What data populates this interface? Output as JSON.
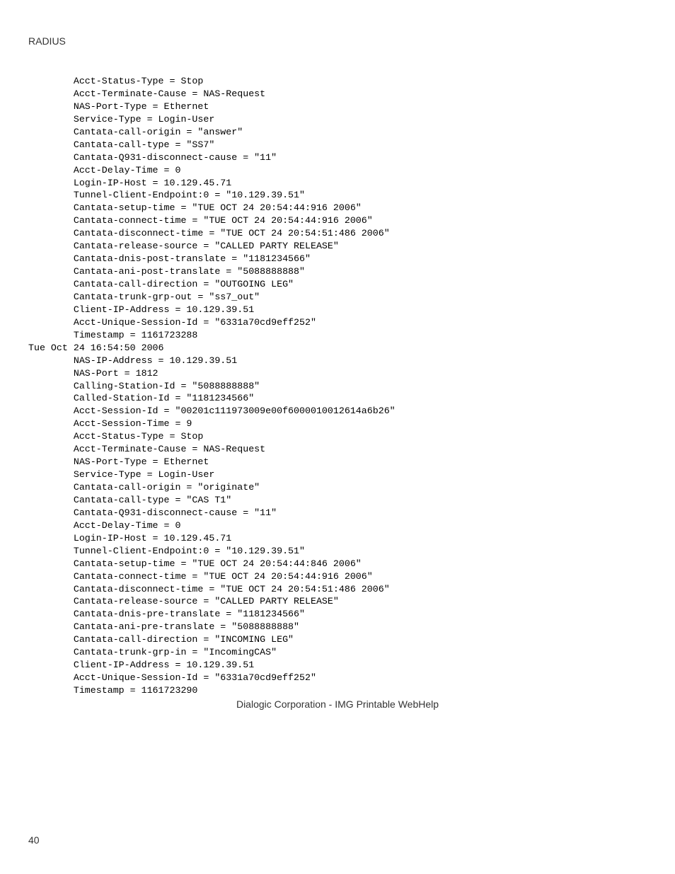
{
  "header": "RADIUS",
  "code": "        Acct-Status-Type = Stop\n        Acct-Terminate-Cause = NAS-Request\n        NAS-Port-Type = Ethernet\n        Service-Type = Login-User\n        Cantata-call-origin = \"answer\"\n        Cantata-call-type = \"SS7\"\n        Cantata-Q931-disconnect-cause = \"11\"\n        Acct-Delay-Time = 0\n        Login-IP-Host = 10.129.45.71\n        Tunnel-Client-Endpoint:0 = \"10.129.39.51\"\n        Cantata-setup-time = \"TUE OCT 24 20:54:44:916 2006\"\n        Cantata-connect-time = \"TUE OCT 24 20:54:44:916 2006\"\n        Cantata-disconnect-time = \"TUE OCT 24 20:54:51:486 2006\"\n        Cantata-release-source = \"CALLED PARTY RELEASE\"\n        Cantata-dnis-post-translate = \"1181234566\"\n        Cantata-ani-post-translate = \"5088888888\"\n        Cantata-call-direction = \"OUTGOING LEG\"\n        Cantata-trunk-grp-out = \"ss7_out\"\n        Client-IP-Address = 10.129.39.51\n        Acct-Unique-Session-Id = \"6331a70cd9eff252\"\n        Timestamp = 1161723288\nTue Oct 24 16:54:50 2006\n        NAS-IP-Address = 10.129.39.51\n        NAS-Port = 1812\n        Calling-Station-Id = \"5088888888\"\n        Called-Station-Id = \"1181234566\"\n        Acct-Session-Id = \"00201c111973009e00f6000010012614a6b26\"\n        Acct-Session-Time = 9\n        Acct-Status-Type = Stop\n        Acct-Terminate-Cause = NAS-Request\n        NAS-Port-Type = Ethernet\n        Service-Type = Login-User\n        Cantata-call-origin = \"originate\"\n        Cantata-call-type = \"CAS T1\"\n        Cantata-Q931-disconnect-cause = \"11\"\n        Acct-Delay-Time = 0\n        Login-IP-Host = 10.129.45.71\n        Tunnel-Client-Endpoint:0 = \"10.129.39.51\"\n        Cantata-setup-time = \"TUE OCT 24 20:54:44:846 2006\"\n        Cantata-connect-time = \"TUE OCT 24 20:54:44:916 2006\"\n        Cantata-disconnect-time = \"TUE OCT 24 20:54:51:486 2006\"\n        Cantata-release-source = \"CALLED PARTY RELEASE\"\n        Cantata-dnis-pre-translate = \"1181234566\"\n        Cantata-ani-pre-translate = \"5088888888\"\n        Cantata-call-direction = \"INCOMING LEG\"\n        Cantata-trunk-grp-in = \"IncomingCAS\"\n        Client-IP-Address = 10.129.39.51\n        Acct-Unique-Session-Id = \"6331a70cd9eff252\"\n        Timestamp = 1161723290",
  "footerCaption": "Dialogic Corporation - IMG Printable WebHelp",
  "pageNumber": "40"
}
